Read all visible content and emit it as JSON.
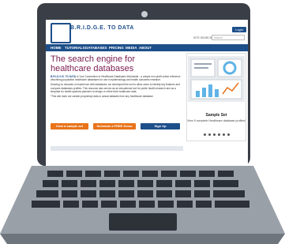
{
  "site": {
    "logo_text": "B.R.I.D.G.E. TO DATA",
    "login_label": "Login",
    "search_label": "SITE SEARCH",
    "search_placeholder": "Search"
  },
  "nav": {
    "items": [
      {
        "label": "HOME"
      },
      {
        "label": "TUTORIALS"
      },
      {
        "label": "DATABASES"
      },
      {
        "label": "PRICING"
      },
      {
        "label": "MEDIA"
      },
      {
        "label": "ABOUT"
      }
    ]
  },
  "hero": {
    "title": "The search engine for healthcare databases",
    "brand": "B.R.I.D.G.E. TO DATA",
    "intro": "is Your Connection to Healthcare Databases Worldwide - a unique non-profit online reference describing population healthcare databases for use in epidemiology and health outcomes research.",
    "paragraph2": "Drawing on decades of experience with databases, we developed this tool to allow users to identify key features and compare databases profiles. This resource also serves as an educational tool for public health research and as a template for health systems planners to design or refine their healthcare data.",
    "paragraph3": "*This site does not contain proprietary data or actual datasets from any healthcare database."
  },
  "buttons": {
    "view_sample": "View a sample set",
    "schedule_demo": "Schedule a FREE Demo",
    "sign_up": "Sign Up"
  },
  "card": {
    "title": "Sample Set",
    "subtitle": "View 5 complete Healthcare database profiles!"
  },
  "colors": {
    "brand_blue": "#1d4f8a",
    "title_plum": "#7a1b4f",
    "orange": "#e8731a",
    "laptop_dark": "#3a3f47"
  }
}
